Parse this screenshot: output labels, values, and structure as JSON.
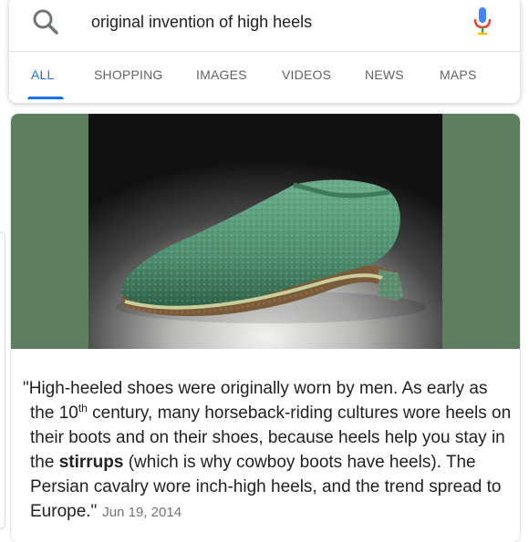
{
  "search": {
    "query": "original invention of high heels"
  },
  "tabs": [
    {
      "label": "ALL",
      "active": true
    },
    {
      "label": "SHOPPING",
      "active": false
    },
    {
      "label": "IMAGES",
      "active": false
    },
    {
      "label": "VIDEOS",
      "active": false
    },
    {
      "label": "NEWS",
      "active": false
    },
    {
      "label": "MAPS",
      "active": false
    }
  ],
  "colors": {
    "accent": "#1a73e8",
    "image_background": "#5d7f60",
    "shoe": "#5a9a7a"
  },
  "icons": {
    "search": "search-icon",
    "mic": "mic-icon"
  },
  "snippet": {
    "part1": "\"High-heeled shoes were originally worn by men. As early as the 10",
    "superscript": "th",
    "part2": " century, many horseback-riding cultures wore heels on their boots and on their shoes, because heels help you stay in the ",
    "bold": "stirrups",
    "part3": " (which is why cowboy boots have heels). The Persian cavalry wore inch-high heels, and the trend spread to Europe.\"",
    "date": "Jun 19, 2014"
  }
}
